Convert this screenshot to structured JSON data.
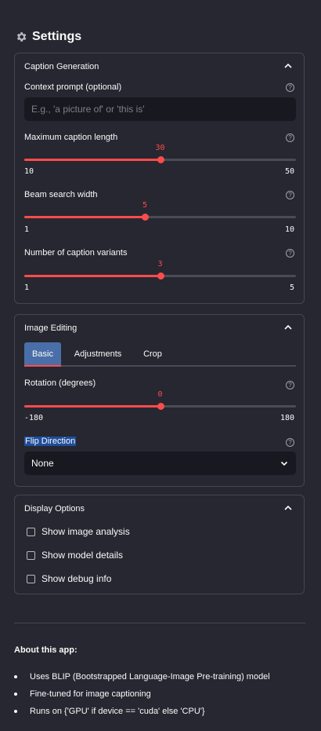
{
  "header": {
    "title": "Settings",
    "icon": "gear-icon"
  },
  "caption": {
    "heading": "Caption Generation",
    "context_label": "Context prompt (optional)",
    "context_placeholder": "E.g., 'a picture of' or 'this is'",
    "context_value": "",
    "max_len": {
      "label": "Maximum caption length",
      "value": "30",
      "min": "10",
      "max": "50",
      "fraction": 0.5
    },
    "beam": {
      "label": "Beam search width",
      "value": "5",
      "min": "1",
      "max": "10",
      "fraction": 0.444
    },
    "variants": {
      "label": "Number of caption variants",
      "value": "3",
      "min": "1",
      "max": "5",
      "fraction": 0.5
    }
  },
  "editing": {
    "heading": "Image Editing",
    "tabs": [
      "Basic",
      "Adjustments",
      "Crop"
    ],
    "rotation": {
      "label": "Rotation (degrees)",
      "value": "0",
      "min": "-180",
      "max": "180",
      "fraction": 0.5
    },
    "flip_label": "Flip Direction",
    "flip_value": "None"
  },
  "display": {
    "heading": "Display Options",
    "options": [
      "Show image analysis",
      "Show model details",
      "Show debug info"
    ]
  },
  "about": {
    "title": "About this app:",
    "items": [
      "Uses BLIP (Bootstrapped Language-Image Pre-training) model",
      "Fine-tuned for image captioning",
      "Runs on {'GPU' if device == 'cuda' else 'CPU'}"
    ]
  },
  "colors": {
    "accent": "#ff4b4b",
    "background": "#262730",
    "input_bg": "#181920",
    "tab_active": "#4a6fa8"
  }
}
